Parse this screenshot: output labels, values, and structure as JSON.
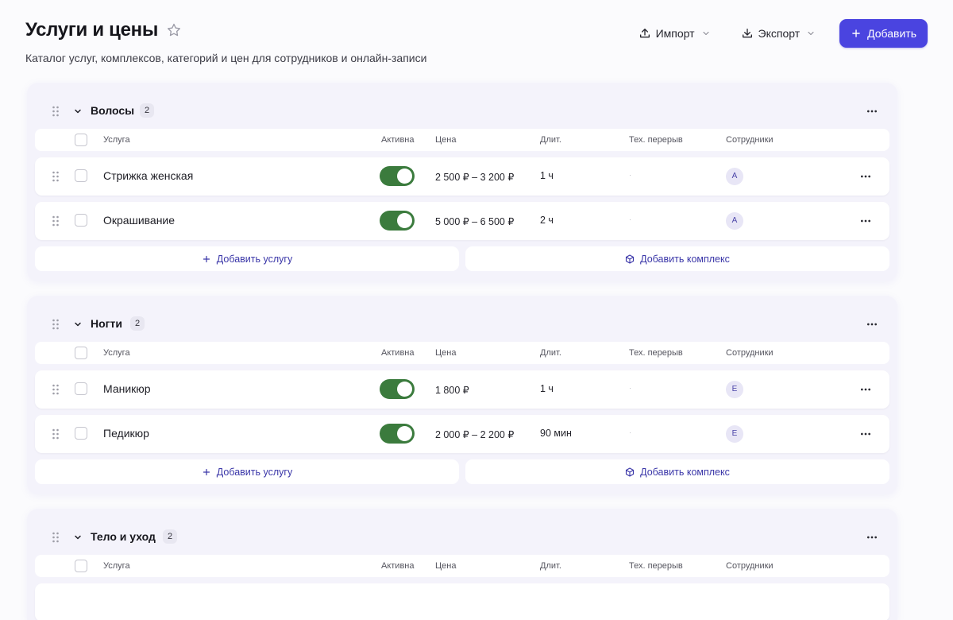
{
  "header": {
    "title": "Услуги и цены",
    "subtitle": "Каталог услуг, комплексов, категорий и цен для сотрудников и онлайн-записи",
    "import_label": "Импорт",
    "export_label": "Экспорт",
    "add_label": "Добавить"
  },
  "columns": {
    "service": "Услуга",
    "active": "Активна",
    "price": "Цена",
    "duration": "Длит.",
    "break": "Тех. перерыв",
    "staff": "Сотрудники"
  },
  "groups": [
    {
      "name": "Волосы",
      "count": "2",
      "rows": [
        {
          "name": "Стрижка женская",
          "active": true,
          "price": "2 500 ₽ – 3 200 ₽",
          "duration": "1 ч",
          "break": "·",
          "staff": "А"
        },
        {
          "name": "Окрашивание",
          "active": true,
          "price": "5 000 ₽ – 6 500 ₽",
          "duration": "2 ч",
          "break": "·",
          "staff": "А"
        }
      ],
      "add_service": "Добавить услугу",
      "add_complex": "Добавить комплекс"
    },
    {
      "name": "Ногти",
      "count": "2",
      "rows": [
        {
          "name": "Маникюр",
          "active": true,
          "price": "1 800 ₽",
          "duration": "1 ч",
          "break": "·",
          "staff": "Е"
        },
        {
          "name": "Педикюр",
          "active": true,
          "price": "2 000 ₽ – 2 200 ₽",
          "duration": "90 мин",
          "break": "·",
          "staff": "Е"
        }
      ],
      "add_service": "Добавить услугу",
      "add_complex": "Добавить комплекс"
    },
    {
      "name": "Тело и уход",
      "count": "2"
    }
  ],
  "colors": {
    "accent": "#4a44e0",
    "toggle_on": "#3b7b3d"
  },
  "icons": {
    "favorite": "star-icon",
    "import": "upload-icon",
    "export": "download-icon",
    "add": "plus-icon",
    "drag": "drag-handle-icon",
    "collapse": "chevron-down-icon",
    "more": "more-horizontal-icon",
    "complex": "package-icon"
  }
}
